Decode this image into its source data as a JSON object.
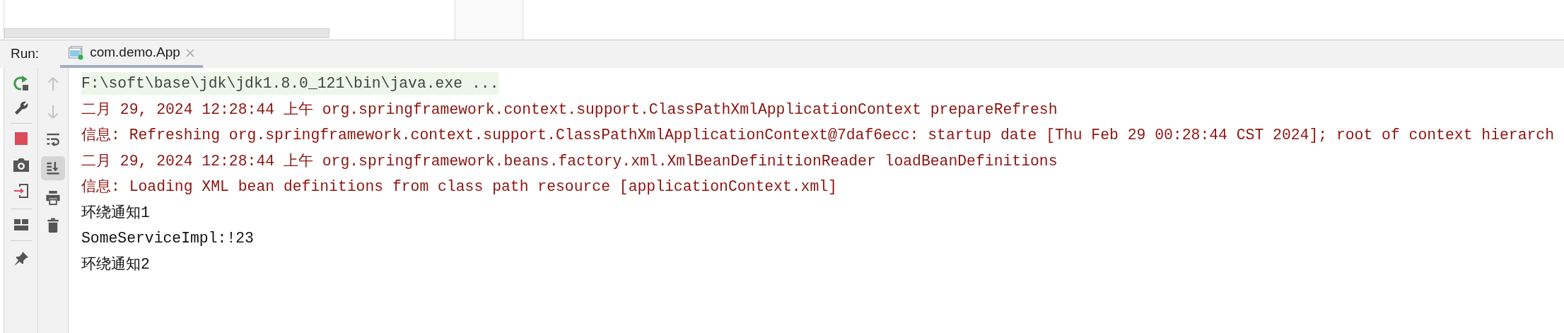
{
  "run_bar": {
    "label": "Run:",
    "tabs": [
      {
        "label": "com.demo.App",
        "selected": true
      }
    ]
  },
  "console_toolbar": [
    {
      "kind": "up",
      "disabled": true
    },
    {
      "kind": "down",
      "disabled": true
    },
    {
      "kind": "wrap",
      "on": false
    },
    {
      "kind": "scroll-end",
      "on": true
    },
    {
      "kind": "print",
      "on": false
    },
    {
      "kind": "clear",
      "on": false
    }
  ],
  "console": [
    {
      "kind": "command",
      "text": "F:\\soft\\base\\jdk\\jdk1.8.0_121\\bin\\java.exe ..."
    },
    {
      "kind": "stderr",
      "text": "二月 29, 2024 12:28:44 上午 org.springframework.context.support.ClassPathXmlApplicationContext prepareRefresh"
    },
    {
      "kind": "stderr",
      "text": "信息: Refreshing org.springframework.context.support.ClassPathXmlApplicationContext@7daf6ecc: startup date [Thu Feb 29 00:28:44 CST 2024]; root of context hierarch"
    },
    {
      "kind": "stderr",
      "text": "二月 29, 2024 12:28:44 上午 org.springframework.beans.factory.xml.XmlBeanDefinitionReader loadBeanDefinitions"
    },
    {
      "kind": "stderr",
      "text": "信息: Loading XML bean definitions from class path resource [applicationContext.xml]"
    },
    {
      "kind": "stdout",
      "text": "环绕通知1"
    },
    {
      "kind": "stdout",
      "text": "SomeServiceImpl:!23"
    },
    {
      "kind": "stdout",
      "text": "环绕通知2"
    }
  ]
}
